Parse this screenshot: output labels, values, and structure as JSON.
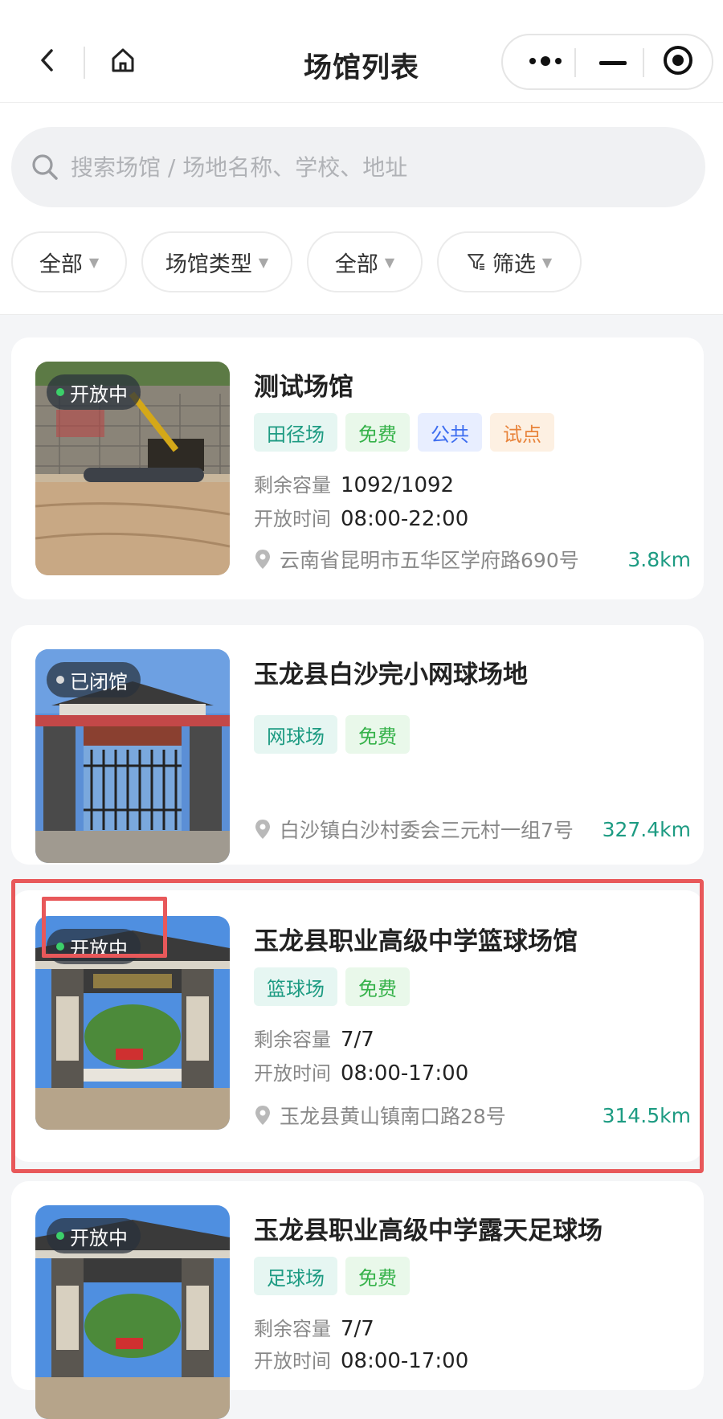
{
  "header": {
    "title": "场馆列表",
    "icons": [
      "back-icon",
      "home-icon",
      "more-icon",
      "minimize-icon",
      "close-circle-icon"
    ]
  },
  "search": {
    "placeholder": "搜索场馆 / 场地名称、学校、地址",
    "icon": "search-icon"
  },
  "filters": [
    {
      "label": "全部"
    },
    {
      "label": "场馆类型"
    },
    {
      "label": "全部"
    },
    {
      "label": "筛选",
      "icon": "filter-icon"
    }
  ],
  "labels": {
    "capacity": "剩余容量",
    "hours": "开放时间"
  },
  "venues": [
    {
      "status": "开放中",
      "name": "测试场馆",
      "tags": [
        "田径场",
        "免费",
        "公共",
        "试点"
      ],
      "capacity": "1092/1092",
      "hours": "08:00-22:00",
      "address": "云南省昆明市五华区学府路690号",
      "distance": "3.8km"
    },
    {
      "status": "已闭馆",
      "name": "玉龙县白沙完小网球场地",
      "tags": [
        "网球场",
        "免费"
      ],
      "address": "白沙镇白沙村委会三元村一组7号",
      "distance": "327.4km"
    },
    {
      "status": "开放中",
      "name": "玉龙县职业高级中学篮球场馆",
      "tags": [
        "篮球场",
        "免费"
      ],
      "capacity": "7/7",
      "hours": "08:00-17:00",
      "address": "玉龙县黄山镇南口路28号",
      "distance": "314.5km"
    },
    {
      "status": "开放中",
      "name": "玉龙县职业高级中学露天足球场",
      "tags": [
        "足球场",
        "免费"
      ],
      "capacity": "7/7",
      "hours": "08:00-17:00"
    }
  ],
  "colors": {
    "accent": "#1d9b82",
    "open_dot": "#3ccf6a",
    "closed_dot": "#d8d8d8",
    "highlight": "#e8585a"
  }
}
